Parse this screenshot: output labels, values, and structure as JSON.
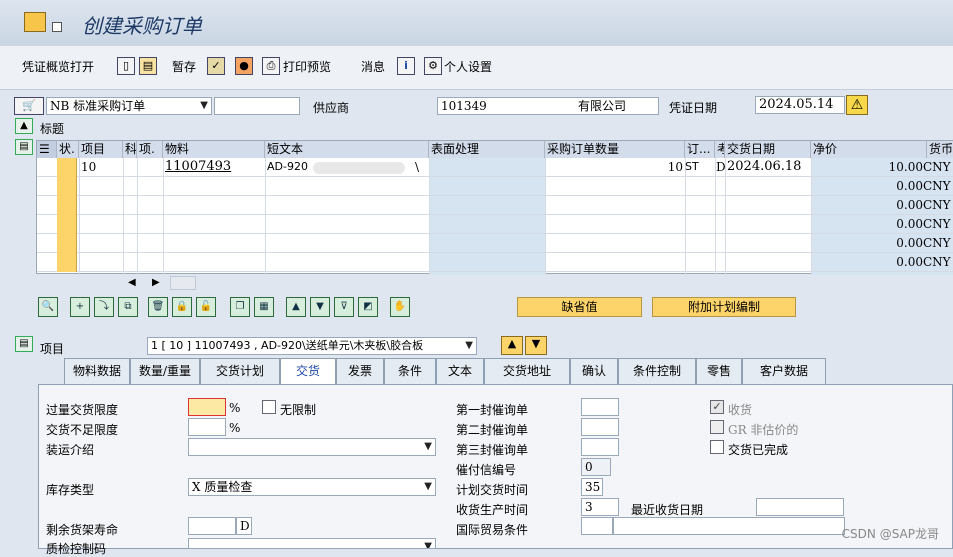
{
  "window": {
    "title": "创建采购订单"
  },
  "toolbar": {
    "overview_label": "凭证概览打开",
    "save_label": "暂存",
    "print_preview_label": "打印预览",
    "messages_label": "消息",
    "personal_settings_label": "个人设置"
  },
  "header": {
    "doc_type_value": "NB 标准采购订单",
    "vendor_label": "供应商",
    "vendor_value": "101349",
    "vendor_name_suffix": "有限公司",
    "doc_date_label": "凭证日期",
    "doc_date_value": "2024.05.14",
    "title_section_label": "标题"
  },
  "grid": {
    "columns": [
      "状.",
      "项目",
      "科",
      "项.",
      "物料",
      "短文本",
      "表面处理",
      "采购订单数量",
      "订...",
      "考",
      "交货日期",
      "净价",
      "货币"
    ],
    "rows": [
      {
        "item": "10",
        "material": "11007493",
        "short_text": "AD-920",
        "short_text_suffix": "\\",
        "qty": "10",
        "unit": "ST",
        "cat": "D",
        "delivery": "2024.06.18",
        "price": "10.00",
        "currency": "CNY"
      },
      {
        "price": "0.00",
        "currency": "CNY"
      },
      {
        "price": "0.00",
        "currency": "CNY"
      },
      {
        "price": "0.00",
        "currency": "CNY"
      },
      {
        "price": "0.00",
        "currency": "CNY"
      },
      {
        "price": "0.00",
        "currency": "CNY"
      }
    ],
    "default_values_label": "缺省值",
    "additional_planning_label": "附加计划编制"
  },
  "item_detail": {
    "item_label": "项目",
    "item_select_value": "1 [ 10 ] 11007493 , AD-920\\送纸单元\\木夹板\\胶合板",
    "tabs": [
      "物料数据",
      "数量/重量",
      "交货计划",
      "交货",
      "发票",
      "条件",
      "文本",
      "交货地址",
      "确认",
      "条件控制",
      "零售",
      "客户数据"
    ],
    "active_tab": "交货",
    "fields": {
      "overdelivery_label": "过量交货限度",
      "overdelivery_unit": "%",
      "unlimited_label": "无限制",
      "underdelivery_label": "交货不足限度",
      "underdelivery_unit": "%",
      "shipping_instr_label": "装运介绍",
      "stock_type_label": "库存类型",
      "stock_type_value": "X 质量检查",
      "remaining_shelf_label": "剩余货架寿命",
      "remaining_shelf_unit": "D",
      "qi_control_label": "质检控制码",
      "reminder1_label": "第一封催询单",
      "reminder2_label": "第二封催询单",
      "reminder3_label": "第三封催询单",
      "dunning_no_label": "催付信编号",
      "dunning_no_value": "0",
      "planned_delivery_label": "计划交货时间",
      "planned_delivery_value": "35",
      "gr_processing_label": "收货生产时间",
      "gr_processing_value": "3",
      "last_gr_date_label": "最近收货日期",
      "incoterms_label": "国际贸易条件",
      "gr_label": "收货",
      "gr_nonval_label": "GR 非估价的",
      "delivery_complete_label": "交货已完成"
    }
  },
  "watermark": "CSDN @SAP龙哥"
}
